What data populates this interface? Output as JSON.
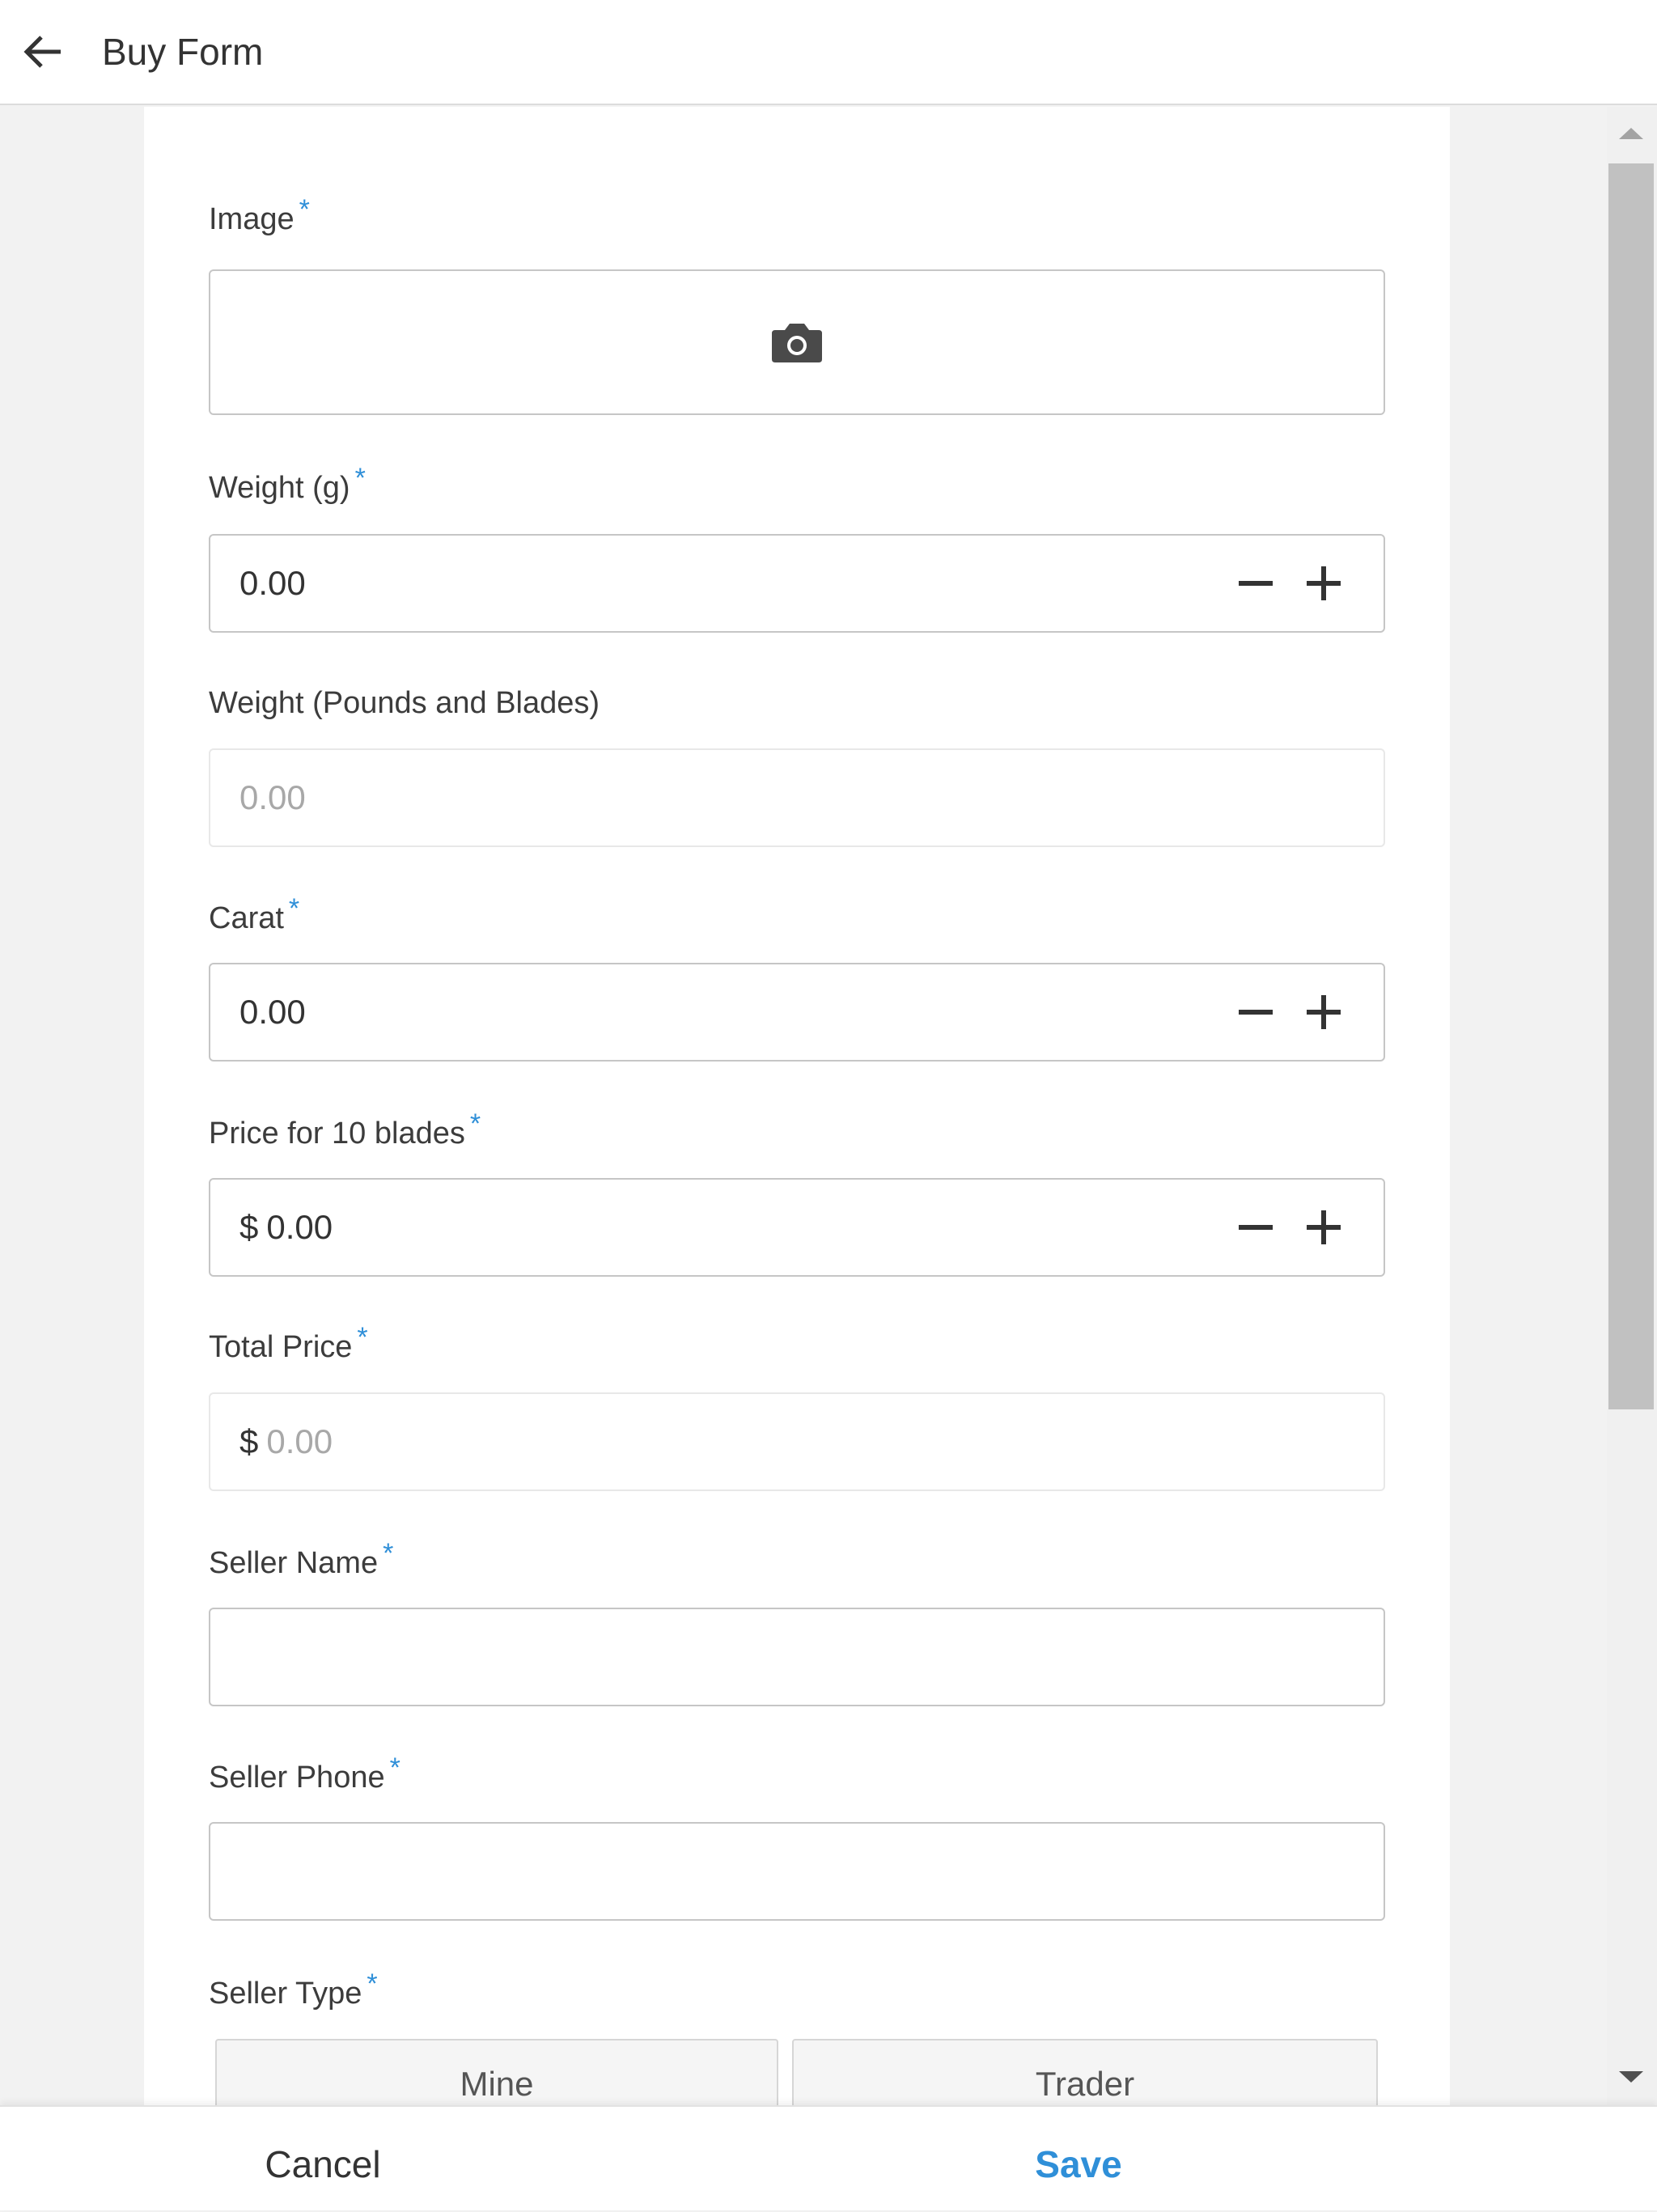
{
  "header": {
    "title": "Buy Form"
  },
  "fields": {
    "image": {
      "label": "Image",
      "required_mark": "*"
    },
    "weight_g": {
      "label": "Weight (g)",
      "required_mark": "*",
      "value": "0.00"
    },
    "weight_pb": {
      "label": "Weight (Pounds and Blades)",
      "placeholder": "0.00"
    },
    "carat": {
      "label": "Carat",
      "required_mark": "*",
      "value": "0.00"
    },
    "price_10": {
      "label": "Price for 10 blades",
      "required_mark": "*",
      "currency": "$",
      "value": "0.00"
    },
    "total_price": {
      "label": "Total Price",
      "required_mark": "*",
      "currency": "$",
      "placeholder": "0.00"
    },
    "seller_name": {
      "label": "Seller Name",
      "required_mark": "*",
      "value": ""
    },
    "seller_phone": {
      "label": "Seller Phone",
      "required_mark": "*",
      "value": ""
    },
    "seller_type": {
      "label": "Seller Type",
      "required_mark": "*",
      "options": [
        "Mine",
        "Trader"
      ]
    }
  },
  "footer": {
    "cancel_label": "Cancel",
    "save_label": "Save"
  },
  "colors": {
    "accent": "#2f8fd8",
    "border": "#c6c6c6",
    "background": "#f2f2f2"
  },
  "icons": {
    "back": "arrow-left-icon",
    "camera": "camera-icon",
    "minus": "minus-icon",
    "plus": "plus-icon"
  }
}
